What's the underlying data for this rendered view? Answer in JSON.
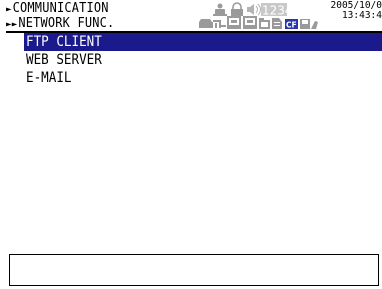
{
  "header": {
    "breadcrumb": [
      {
        "marker": "►",
        "label": "COMMUNICATION"
      },
      {
        "marker": "►►",
        "label": "NETWORK FUNC."
      }
    ],
    "datetime": {
      "date": "2005/10/0",
      "time": "13:43:4"
    },
    "status": {
      "counter_text": "1234",
      "card_label": "CF",
      "icons": [
        "user-icon",
        "lock-icon",
        "speaker-icon",
        "printer-icon",
        "network-icon",
        "computer-icon",
        "folder-icon",
        "document-icon",
        "card-icon",
        "disk-icon",
        "hand-icon"
      ]
    }
  },
  "menu": {
    "items": [
      {
        "label": "FTP CLIENT",
        "selected": true
      },
      {
        "label": "WEB SERVER",
        "selected": false
      },
      {
        "label": "E-MAIL",
        "selected": false
      }
    ]
  },
  "message": {
    "text": ""
  },
  "colors": {
    "selection": "#1a1a8c",
    "icon_gray": "#9a9a9a",
    "card_blue": "#2a35b0"
  }
}
